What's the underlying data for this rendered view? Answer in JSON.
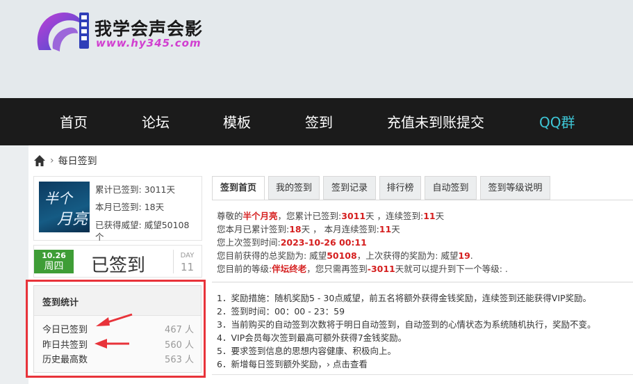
{
  "header": {
    "logo_title": "我学会声会影",
    "logo_url": "www.hy345.com"
  },
  "nav": {
    "items": [
      "首页",
      "论坛",
      "模板",
      "签到",
      "充值未到账提交",
      "QQ群"
    ],
    "highlight_color": "#3ec6d6"
  },
  "breadcrumb": {
    "home_icon": "home-icon",
    "current": "每日签到"
  },
  "profile": {
    "avatar_text_1": "半个",
    "avatar_text_2": "月亮",
    "total_label": "累计已签到:",
    "total_value": "3011天",
    "month_label": "本月已签到:",
    "month_value": "18天",
    "reward_label": "已获得威望:",
    "reward_value": "威望50108",
    "reward_unit": "个"
  },
  "sign": {
    "date": "10.26",
    "weekday": "周四",
    "status": "已签到",
    "day_label": "DAY",
    "day_value": "11"
  },
  "stats": {
    "title": "签到统计",
    "rows": [
      {
        "label": "今日已签到",
        "value": "467 人"
      },
      {
        "label": "昨日共签到",
        "value": "560 人"
      },
      {
        "label": "历史最高数",
        "value": "563 人"
      }
    ]
  },
  "tabs": [
    "签到首页",
    "我的签到",
    "签到记录",
    "排行榜",
    "自动签到",
    "签到等级说明"
  ],
  "info": {
    "l1_a": "尊敬的",
    "l1_name": "半个月亮",
    "l1_b": "，您累计已签到:",
    "l1_total": "3011",
    "l1_c": "天 ，连续签到:",
    "l1_streak": "11",
    "l1_d": "天",
    "l2_a": "您本月已累计签到:",
    "l2_month": "18",
    "l2_b": "天 ， 本月连续签到:",
    "l2_mstreak": "11",
    "l2_c": "天",
    "l3_a": "您上次签到时间:",
    "l3_time": "2023-10-26 00:11",
    "l4_a": "您目前获得的总奖励为: 威望",
    "l4_total": "50108",
    "l4_b": "，上次获得的奖励为: 威望",
    "l4_last": "19",
    "l4_c": ".",
    "l5_a": "您目前的等级:",
    "l5_level": "伴坛终老",
    "l5_b": "，您只需再签到",
    "l5_need": "-3011",
    "l5_c": "天就可以提升到下一个等级: ."
  },
  "rules": [
    "1．奖励措施：随机奖励5 - 30点威望，前五名将额外获得金钱奖励，连续签到还能获得VIP奖励。",
    "2．签到时间：00：00 - 23：59",
    "3．当前购买的自动签到次数将于明日自动签到，自动签到的心情状态为系统随机执行，奖励不变。",
    "4．VIP会员每次签到最高可额外获得7金钱奖励。",
    "5．要求签到信息的思想内容健康、积极向上。",
    "6．新增每日签到额外奖励，› 点击查看"
  ],
  "colors": {
    "accent_red": "#d51f1f",
    "badge_green": "#3e9d36",
    "annotation_red": "#e8333a",
    "nav_bg": "#1b1b1b"
  }
}
